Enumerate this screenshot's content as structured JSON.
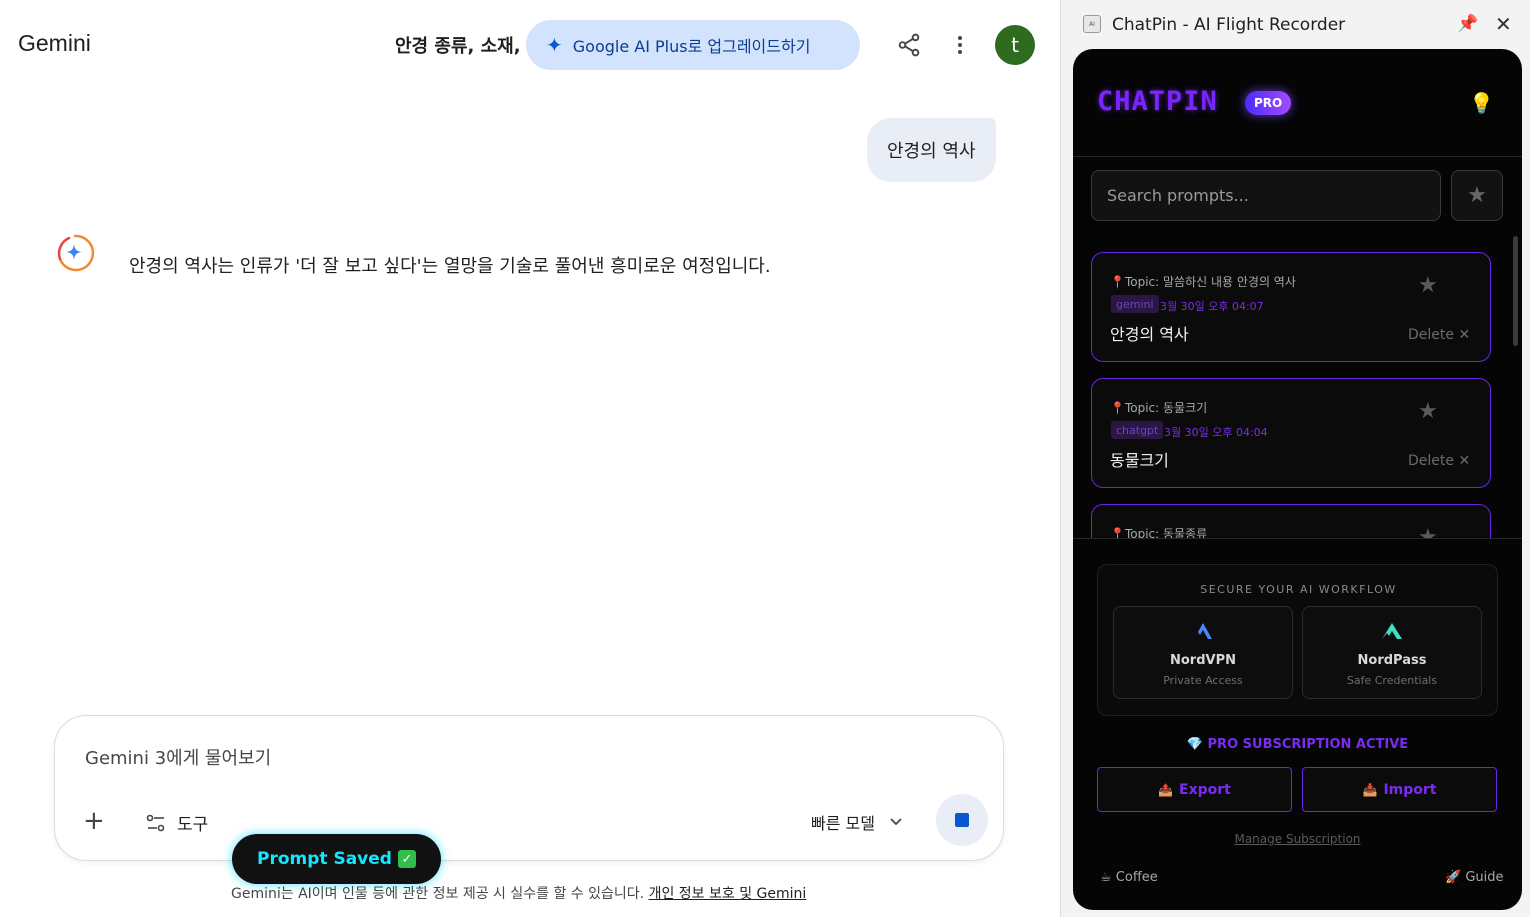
{
  "gemini": {
    "logo": "Gemini",
    "conversation_title": "안경 종류, 소재,",
    "upgrade_label": "Google AI Plus로 업그레이드하기",
    "avatar_letter": "t",
    "user_message": "안경의 역사",
    "answer": "안경의 역사는 인류가 '더 잘 보고 싶다'는 열망을 기술로 풀어낸 흥미로운 여정입니다.",
    "input_placeholder": "Gemini 3에게 물어보기",
    "tools_label": "도구",
    "model_label": "빠른 모델",
    "toast": "Prompt Saved",
    "disclaimer": "Gemini는 AI이며 인물 등에 관한 정보 제공 시 실수를 할 수 있습니다.",
    "disclaimer_link": "개인 정보 보호 및 Gemini",
    "accent_blue": "#0b57d0"
  },
  "chatpin": {
    "window_title": "ChatPin - AI Flight Recorder",
    "logo": "CHATPIN",
    "badge": "PRO",
    "search_placeholder": "Search prompts...",
    "cards": [
      {
        "topic": "Topic: 말씀하신 내용 안경의 역사",
        "source": "gemini",
        "date": "3월 30일 오후 04:07",
        "title": "안경의 역사",
        "delete": "Delete"
      },
      {
        "topic": "Topic: 동물크기",
        "source": "chatgpt",
        "date": "3월 30일 오후 04:04",
        "title": "동물크기",
        "delete": "Delete"
      },
      {
        "topic": "Topic: 동물종류",
        "source": "",
        "date": "",
        "title": "",
        "delete": ""
      }
    ],
    "secure_caption": "SECURE YOUR AI WORKFLOW",
    "partners": [
      {
        "name": "NordVPN",
        "sub": "Private Access",
        "icon": "nordvpn-icon"
      },
      {
        "name": "NordPass",
        "sub": "Safe Credentials",
        "icon": "nordpass-icon"
      }
    ],
    "pro_status": "PRO SUBSCRIPTION ACTIVE",
    "export_label": "Export",
    "import_label": "Import",
    "manage_label": "Manage Subscription",
    "coffee_label": "Coffee",
    "guide_label": "Guide",
    "accent_purple": "#7a2cf0"
  }
}
